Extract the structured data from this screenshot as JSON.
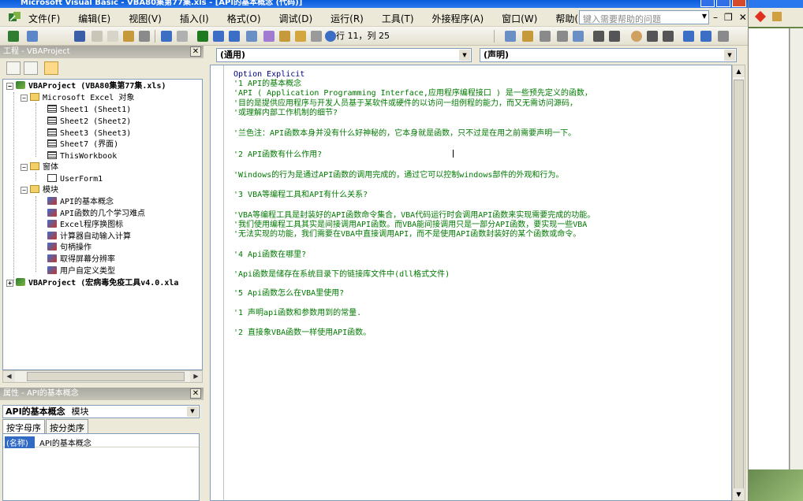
{
  "window": {
    "title": "Microsoft Visual Basic - VBA80集第77集.xls - [API的基本概念 (代码)]"
  },
  "menu": {
    "items": [
      "文件(F)",
      "编辑(E)",
      "视图(V)",
      "插入(I)",
      "格式(O)",
      "调试(D)",
      "运行(R)",
      "工具(T)",
      "外接程序(A)",
      "窗口(W)",
      "帮助(H)"
    ],
    "help_placeholder": "键入需要帮助的问题"
  },
  "toolbar": {
    "status": "行 11，列 25"
  },
  "project": {
    "header": "工程 - VBAProject",
    "tree": [
      {
        "label": "VBAProject (VBA80集第77集.xls)",
        "bold": true
      },
      {
        "label": "Microsoft Excel 对象"
      },
      {
        "label": "Sheet1 (Sheet1)"
      },
      {
        "label": "Sheet2 (Sheet2)"
      },
      {
        "label": "Sheet3 (Sheet3)"
      },
      {
        "label": "Sheet7 (界面)"
      },
      {
        "label": "ThisWorkbook"
      },
      {
        "label": "窗体"
      },
      {
        "label": "UserForm1"
      },
      {
        "label": "模块"
      },
      {
        "label": "API的基本概念"
      },
      {
        "label": "API函数的几个学习难点"
      },
      {
        "label": "Excel程序换图标"
      },
      {
        "label": "计算器自动输入计算"
      },
      {
        "label": "句柄操作"
      },
      {
        "label": "取得屏幕分辨率"
      },
      {
        "label": "用户自定义类型"
      },
      {
        "label": "VBAProject (宏病毒免疫工具v4.0.xla",
        "bold": true
      }
    ]
  },
  "properties": {
    "header": "属性 - API的基本概念",
    "object_name": "API的基本概念",
    "object_type": "模块",
    "tabs": [
      "按字母序",
      "按分类序"
    ],
    "rows": [
      {
        "name": "(名称)",
        "value": "API的基本概念"
      }
    ]
  },
  "code": {
    "object_dropdown": "(通用)",
    "procedure_dropdown": "(声明)",
    "lines": [
      "Option Explicit",
      "'1 API的基本概念",
      "    'API ( Application Programming Interface,应用程序编程接口 ) 是一些预先定义的函数，",
      " '目的是提供应用程序与开发人员基于某软件或硬件的以访问一组例程的能力，而又无需访问源码，",
      " '或理解内部工作机制的细节?",
      "",
      "  '兰色注：API函数本身并没有什么好神秘的，它本身就是函数，只不过是在用之前需要声明一下。",
      "",
      "'2 API函数有什么作用?",
      "",
      "    'Windows的行为是通过API函数的调用完成的，通过它可以控制windows部件的外观和行为。",
      "",
      "'3 VBA等编程工具和API有什么关系?",
      "",
      "    'VBA等编程工具是封装好的API函数命令集合，VBA代码运行时会调用API函数来实现需要完成的功能。",
      " '我们使用编程工具其实是间接调用API函数。而VBA能间接调用只是一部分API函数，要实现一些VBA",
      " '无法实现的功能，我们需要在VBA中直接调用API，而不是使用API函数封装好的某个函数或命令。",
      "",
      "'4 Api函数在哪里?",
      "",
      "   'Api函数是储存在系统目录下的链接库文件中(dll格式文件)",
      "",
      "'5 Api函数怎么在VBA里使用?",
      "",
      "  '1 声明api函数和参数用到的常量.",
      "",
      "  '2 直接象VBA函数一样使用API函数。"
    ]
  },
  "colors": {
    "code_comment": "#007a00",
    "code_keyword": "#000080",
    "selection": "#316ac5"
  }
}
